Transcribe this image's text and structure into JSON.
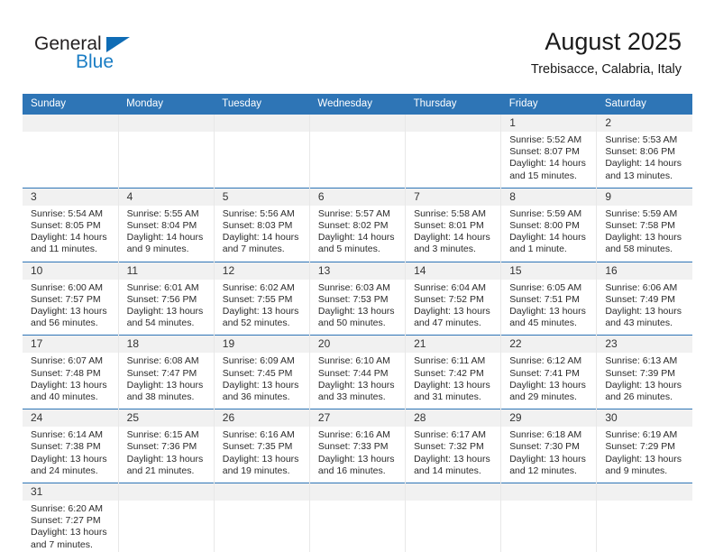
{
  "brand": {
    "name_part1": "General",
    "name_part2": "Blue",
    "triangle_color": "#0f6cb5",
    "blue_text_color": "#1a7dc4"
  },
  "header": {
    "title": "August 2025",
    "subtitle": "Trebisacce, Calabria, Italy"
  },
  "theme": {
    "header_row_bg": "#2e75b6",
    "daynum_bg": "#f1f1f1",
    "row_divider": "#2e75b6",
    "cell_divider": "#e8e8e8",
    "text": "#2b2b2b"
  },
  "weekdays": [
    "Sunday",
    "Monday",
    "Tuesday",
    "Wednesday",
    "Thursday",
    "Friday",
    "Saturday"
  ],
  "labels": {
    "sunrise_prefix": "Sunrise: ",
    "sunset_prefix": "Sunset: ",
    "daylight_prefix": "Daylight: "
  },
  "weeks": [
    [
      {
        "day": "",
        "sunrise": "",
        "sunset": "",
        "daylight": "",
        "empty": true
      },
      {
        "day": "",
        "sunrise": "",
        "sunset": "",
        "daylight": "",
        "empty": true
      },
      {
        "day": "",
        "sunrise": "",
        "sunset": "",
        "daylight": "",
        "empty": true
      },
      {
        "day": "",
        "sunrise": "",
        "sunset": "",
        "daylight": "",
        "empty": true
      },
      {
        "day": "",
        "sunrise": "",
        "sunset": "",
        "daylight": "",
        "empty": true
      },
      {
        "day": "1",
        "sunrise": "Sunrise: 5:52 AM",
        "sunset": "Sunset: 8:07 PM",
        "daylight": "Daylight: 14 hours and 15 minutes."
      },
      {
        "day": "2",
        "sunrise": "Sunrise: 5:53 AM",
        "sunset": "Sunset: 8:06 PM",
        "daylight": "Daylight: 14 hours and 13 minutes."
      }
    ],
    [
      {
        "day": "3",
        "sunrise": "Sunrise: 5:54 AM",
        "sunset": "Sunset: 8:05 PM",
        "daylight": "Daylight: 14 hours and 11 minutes."
      },
      {
        "day": "4",
        "sunrise": "Sunrise: 5:55 AM",
        "sunset": "Sunset: 8:04 PM",
        "daylight": "Daylight: 14 hours and 9 minutes."
      },
      {
        "day": "5",
        "sunrise": "Sunrise: 5:56 AM",
        "sunset": "Sunset: 8:03 PM",
        "daylight": "Daylight: 14 hours and 7 minutes."
      },
      {
        "day": "6",
        "sunrise": "Sunrise: 5:57 AM",
        "sunset": "Sunset: 8:02 PM",
        "daylight": "Daylight: 14 hours and 5 minutes."
      },
      {
        "day": "7",
        "sunrise": "Sunrise: 5:58 AM",
        "sunset": "Sunset: 8:01 PM",
        "daylight": "Daylight: 14 hours and 3 minutes."
      },
      {
        "day": "8",
        "sunrise": "Sunrise: 5:59 AM",
        "sunset": "Sunset: 8:00 PM",
        "daylight": "Daylight: 14 hours and 1 minute."
      },
      {
        "day": "9",
        "sunrise": "Sunrise: 5:59 AM",
        "sunset": "Sunset: 7:58 PM",
        "daylight": "Daylight: 13 hours and 58 minutes."
      }
    ],
    [
      {
        "day": "10",
        "sunrise": "Sunrise: 6:00 AM",
        "sunset": "Sunset: 7:57 PM",
        "daylight": "Daylight: 13 hours and 56 minutes."
      },
      {
        "day": "11",
        "sunrise": "Sunrise: 6:01 AM",
        "sunset": "Sunset: 7:56 PM",
        "daylight": "Daylight: 13 hours and 54 minutes."
      },
      {
        "day": "12",
        "sunrise": "Sunrise: 6:02 AM",
        "sunset": "Sunset: 7:55 PM",
        "daylight": "Daylight: 13 hours and 52 minutes."
      },
      {
        "day": "13",
        "sunrise": "Sunrise: 6:03 AM",
        "sunset": "Sunset: 7:53 PM",
        "daylight": "Daylight: 13 hours and 50 minutes."
      },
      {
        "day": "14",
        "sunrise": "Sunrise: 6:04 AM",
        "sunset": "Sunset: 7:52 PM",
        "daylight": "Daylight: 13 hours and 47 minutes."
      },
      {
        "day": "15",
        "sunrise": "Sunrise: 6:05 AM",
        "sunset": "Sunset: 7:51 PM",
        "daylight": "Daylight: 13 hours and 45 minutes."
      },
      {
        "day": "16",
        "sunrise": "Sunrise: 6:06 AM",
        "sunset": "Sunset: 7:49 PM",
        "daylight": "Daylight: 13 hours and 43 minutes."
      }
    ],
    [
      {
        "day": "17",
        "sunrise": "Sunrise: 6:07 AM",
        "sunset": "Sunset: 7:48 PM",
        "daylight": "Daylight: 13 hours and 40 minutes."
      },
      {
        "day": "18",
        "sunrise": "Sunrise: 6:08 AM",
        "sunset": "Sunset: 7:47 PM",
        "daylight": "Daylight: 13 hours and 38 minutes."
      },
      {
        "day": "19",
        "sunrise": "Sunrise: 6:09 AM",
        "sunset": "Sunset: 7:45 PM",
        "daylight": "Daylight: 13 hours and 36 minutes."
      },
      {
        "day": "20",
        "sunrise": "Sunrise: 6:10 AM",
        "sunset": "Sunset: 7:44 PM",
        "daylight": "Daylight: 13 hours and 33 minutes."
      },
      {
        "day": "21",
        "sunrise": "Sunrise: 6:11 AM",
        "sunset": "Sunset: 7:42 PM",
        "daylight": "Daylight: 13 hours and 31 minutes."
      },
      {
        "day": "22",
        "sunrise": "Sunrise: 6:12 AM",
        "sunset": "Sunset: 7:41 PM",
        "daylight": "Daylight: 13 hours and 29 minutes."
      },
      {
        "day": "23",
        "sunrise": "Sunrise: 6:13 AM",
        "sunset": "Sunset: 7:39 PM",
        "daylight": "Daylight: 13 hours and 26 minutes."
      }
    ],
    [
      {
        "day": "24",
        "sunrise": "Sunrise: 6:14 AM",
        "sunset": "Sunset: 7:38 PM",
        "daylight": "Daylight: 13 hours and 24 minutes."
      },
      {
        "day": "25",
        "sunrise": "Sunrise: 6:15 AM",
        "sunset": "Sunset: 7:36 PM",
        "daylight": "Daylight: 13 hours and 21 minutes."
      },
      {
        "day": "26",
        "sunrise": "Sunrise: 6:16 AM",
        "sunset": "Sunset: 7:35 PM",
        "daylight": "Daylight: 13 hours and 19 minutes."
      },
      {
        "day": "27",
        "sunrise": "Sunrise: 6:16 AM",
        "sunset": "Sunset: 7:33 PM",
        "daylight": "Daylight: 13 hours and 16 minutes."
      },
      {
        "day": "28",
        "sunrise": "Sunrise: 6:17 AM",
        "sunset": "Sunset: 7:32 PM",
        "daylight": "Daylight: 13 hours and 14 minutes."
      },
      {
        "day": "29",
        "sunrise": "Sunrise: 6:18 AM",
        "sunset": "Sunset: 7:30 PM",
        "daylight": "Daylight: 13 hours and 12 minutes."
      },
      {
        "day": "30",
        "sunrise": "Sunrise: 6:19 AM",
        "sunset": "Sunset: 7:29 PM",
        "daylight": "Daylight: 13 hours and 9 minutes."
      }
    ],
    [
      {
        "day": "31",
        "sunrise": "Sunrise: 6:20 AM",
        "sunset": "Sunset: 7:27 PM",
        "daylight": "Daylight: 13 hours and 7 minutes."
      },
      {
        "day": "",
        "sunrise": "",
        "sunset": "",
        "daylight": "",
        "empty": true
      },
      {
        "day": "",
        "sunrise": "",
        "sunset": "",
        "daylight": "",
        "empty": true
      },
      {
        "day": "",
        "sunrise": "",
        "sunset": "",
        "daylight": "",
        "empty": true
      },
      {
        "day": "",
        "sunrise": "",
        "sunset": "",
        "daylight": "",
        "empty": true
      },
      {
        "day": "",
        "sunrise": "",
        "sunset": "",
        "daylight": "",
        "empty": true
      },
      {
        "day": "",
        "sunrise": "",
        "sunset": "",
        "daylight": "",
        "empty": true
      }
    ]
  ]
}
